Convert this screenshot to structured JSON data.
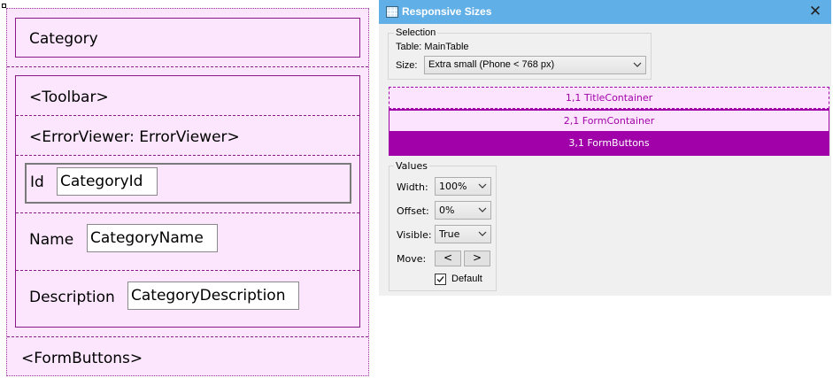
{
  "designer": {
    "title_container": "Category",
    "toolbar": "<Toolbar>",
    "error_viewer": "<ErrorViewer: ErrorViewer>",
    "fields": [
      {
        "label": "Id",
        "value": "CategoryId"
      },
      {
        "label": "Name",
        "value": "CategoryName"
      },
      {
        "label": "Description",
        "value": "CategoryDescription"
      }
    ],
    "form_buttons": "<FormButtons>"
  },
  "dialog": {
    "title": "Responsive Sizes",
    "close_icon": "close-icon",
    "selection": {
      "group_title": "Selection",
      "table_text": "Table: MainTable",
      "size_label": "Size:",
      "size_value": "Extra small (Phone < 768 px)"
    },
    "rows": [
      {
        "label": "1,1 TitleContainer",
        "selected": false
      },
      {
        "label": "2,1 FormContainer",
        "selected": false
      },
      {
        "label": "3,1 FormButtons",
        "selected": true
      }
    ],
    "values": {
      "group_title": "Values",
      "width_label": "Width:",
      "width_value": "100%",
      "offset_label": "Offset:",
      "offset_value": "0%",
      "visible_label": "Visible:",
      "visible_value": "True",
      "move_label": "Move:",
      "move_left": "<",
      "move_right": ">",
      "default_label": "Default",
      "default_checked": true
    },
    "colors": {
      "titlebar": "#61afe7",
      "row_border": "#a001a8",
      "row_text": "#a001a8",
      "row_selected_bg": "#a001a8",
      "row_bg": "#fde4fe",
      "designer_bg": "#fce6fe"
    }
  }
}
